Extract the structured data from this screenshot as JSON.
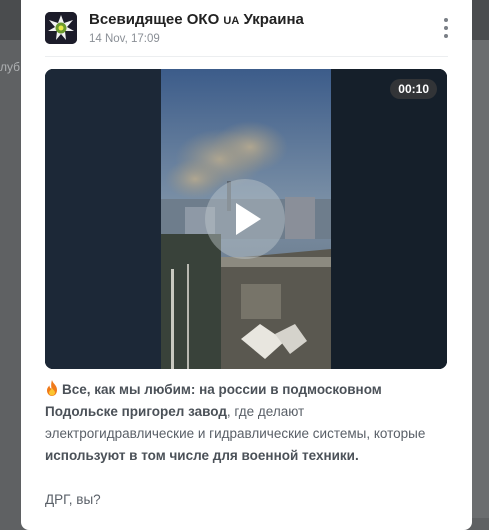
{
  "background": {
    "side_text": "луб"
  },
  "post": {
    "channel_name": "Всевидящее ОКО 🇺🇦 Украина",
    "channel_name_parts": {
      "prefix": "Всевидящее ОКО ",
      "flag": "UA",
      "suffix": " Украина"
    },
    "date": "14 Nov, 17:09",
    "video": {
      "duration": "00:10"
    },
    "text": {
      "lead_bold": "Все, как мы любим: на россии в подмосковном Подольске пригорел завод",
      "part2": ", где делают электрогидравлические и гидравлические системы, которые ",
      "bold2": "используют в том числе для военной техники.",
      "question": "ДРГ, вы?"
    },
    "icons": {
      "avatar": "eye-emblem-icon",
      "menu": "more-vertical-icon",
      "play": "play-icon",
      "fire": "fire-icon"
    },
    "colors": {
      "accent": "#1f1f2b",
      "text": "#5a6068",
      "title": "#222222"
    }
  }
}
